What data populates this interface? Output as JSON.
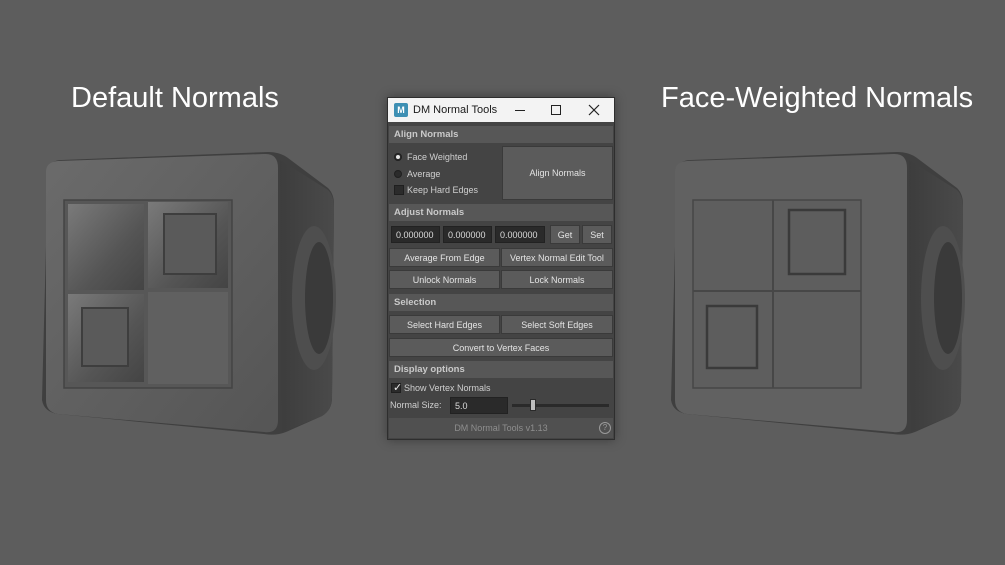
{
  "captions": {
    "left": "Default Normals",
    "right": "Face-Weighted Normals"
  },
  "window": {
    "title": "DM Normal Tools",
    "icon_letter": "M",
    "controls": [
      "minimize-icon",
      "maximize-icon",
      "close-icon"
    ]
  },
  "align": {
    "header": "Align Normals",
    "options": [
      "Face Weighted",
      "Average"
    ],
    "selected": "Face Weighted",
    "keep_hard_edges": "Keep Hard Edges",
    "keep_hard_edges_checked": false,
    "button": "Align Normals"
  },
  "adjust": {
    "header": "Adjust Normals",
    "values": [
      "0.000000",
      "0.000000",
      "0.000000"
    ],
    "get": "Get",
    "set": "Set",
    "average_from_edge": "Average From Edge",
    "vertex_normal_edit_tool": "Vertex Normal Edit Tool",
    "unlock": "Unlock Normals",
    "lock": "Lock Normals"
  },
  "selection": {
    "header": "Selection",
    "hard": "Select Hard Edges",
    "soft": "Select Soft Edges",
    "convert": "Convert to Vertex Faces"
  },
  "display": {
    "header": "Display options",
    "show_vertex_normals": "Show Vertex Normals",
    "show_vertex_normals_checked": true,
    "normal_size_label": "Normal Size:",
    "normal_size_value": "5.0",
    "slider_fraction": 0.22
  },
  "footer": {
    "version": "DM Normal Tools v1.13",
    "help": "?"
  }
}
